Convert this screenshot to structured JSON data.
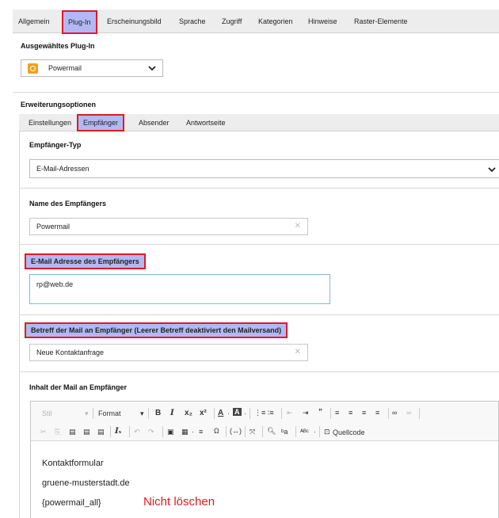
{
  "top_tabs": [
    "Allgemein",
    "Plug-In",
    "Erscheinungsbild",
    "Sprache",
    "Zugriff",
    "Kategorien",
    "Hinweise",
    "Raster-Elemente"
  ],
  "plugin_section": {
    "title": "Ausgewähltes Plug-In",
    "selected": "Powermail"
  },
  "extension": {
    "title": "Erweiterungsoptionen",
    "tabs": [
      "Einstellungen",
      "Empfänger",
      "Absender",
      "Antwortseite"
    ]
  },
  "receiver_type": {
    "label": "Empfänger-Typ",
    "value": "E-Mail-Adressen"
  },
  "receiver_name": {
    "label": "Name des Empfängers",
    "value": "Powermail"
  },
  "receiver_email": {
    "label": "E-Mail Adresse des Empfängers",
    "value": "rp@web.de"
  },
  "subject": {
    "label": "Betreff der Mail an Empfänger (Leerer Betreff deaktiviert den Mailversand)",
    "value": "Neue Kontaktanfrage"
  },
  "body": {
    "label": "Inhalt der Mail an Empfänger",
    "toolbar": {
      "style": "Stil",
      "format": "Format",
      "source": "Quellcode"
    },
    "lines": [
      "Kontaktformular",
      "gruene-musterstadt.de",
      "{powermail_all}"
    ],
    "warning": "Nicht löschen"
  },
  "colors": {
    "highlight": "#b3b8f4",
    "border": "#e01b24",
    "warning": "#e01b24"
  }
}
